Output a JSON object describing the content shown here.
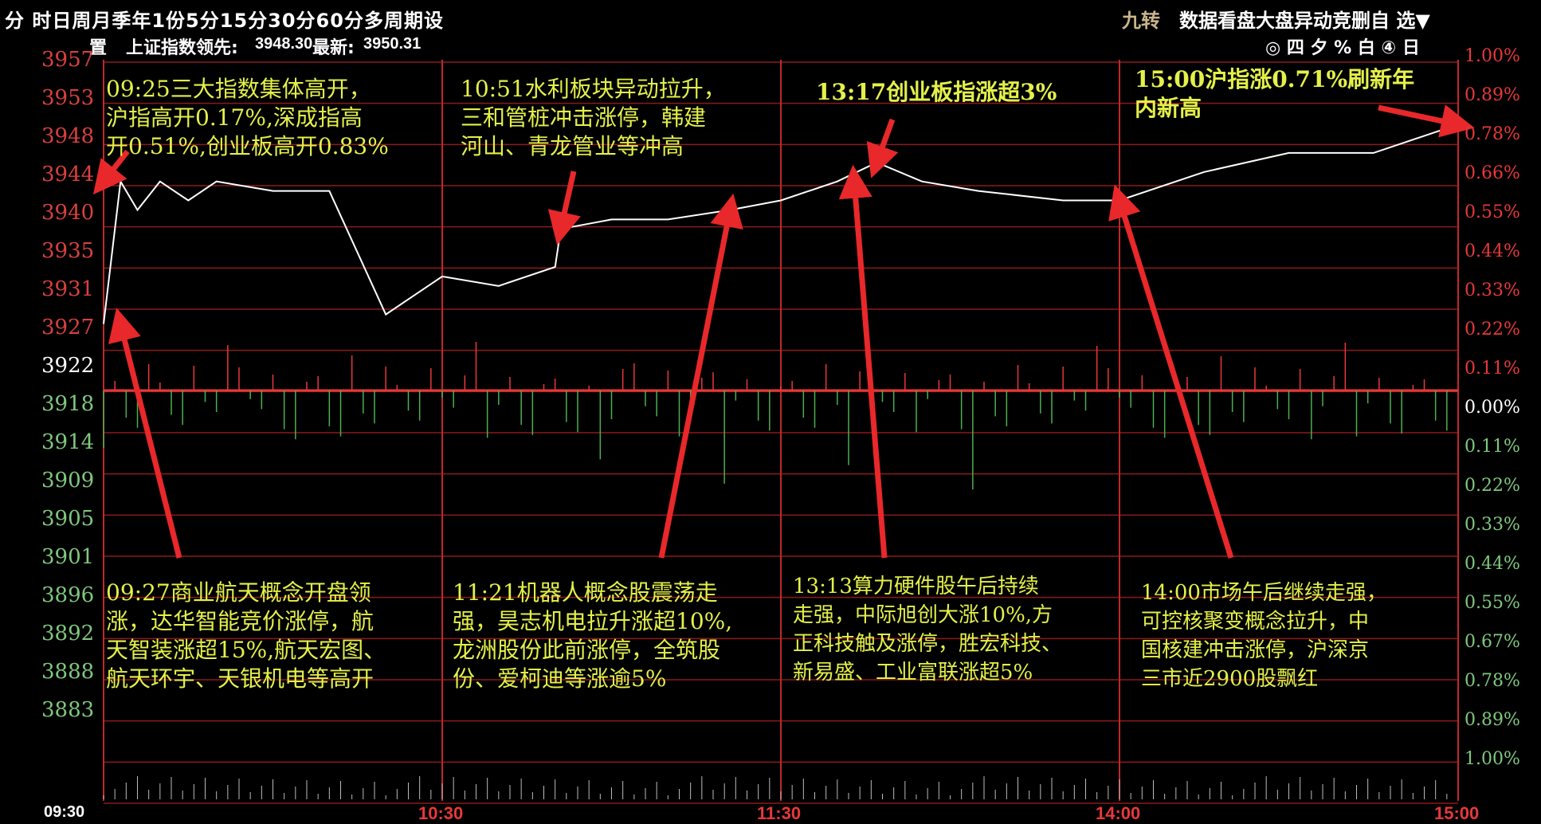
{
  "toolbar": {
    "period_menu": "分 时日周月季年1份5分15分30分60分多周期设",
    "period_menu_2": "置",
    "index_label": "上证指数领先:",
    "lead_value": "3948.30",
    "latest_label": "最新:",
    "latest_value": "3950.31",
    "right_menu_1": "九转",
    "right_menu_2": "数据看盘大盘异动竞删自 选▼",
    "right_icons": "◎ 四 夕 % 白 ④ 日"
  },
  "annotations": [
    {
      "id": "a1",
      "text": "09:25三大指数集体高开，\n沪指高开0.17%,深成指高\n开0.51%,创业板高开0.83%"
    },
    {
      "id": "a2",
      "text": "10:51水利板块异动拉升，\n三和管桩冲击涨停，韩建\n河山、青龙管业等冲高"
    },
    {
      "id": "a3",
      "text": "13:17创业板指涨超3%"
    },
    {
      "id": "a4",
      "text": "15:00沪指涨0.71%刷新年\n内新高"
    },
    {
      "id": "a5",
      "text": "09:27商业航天概念开盘领\n涨，达华智能竞价涨停，航\n天智装涨超15%,航天宏图、\n航天环宇、天银机电等高开"
    },
    {
      "id": "a6",
      "text": "11:21机器人概念股震荡走\n强，昊志机电拉升涨超10%,\n龙洲股份此前涨停，全筑股\n份、爱柯迪等涨逾5%"
    },
    {
      "id": "a7",
      "text": "13:13算力硬件股午后持续\n走强，中际旭创大涨10%,方\n正科技触及涨停，胜宏科技、\n新易盛、工业富联涨超5%"
    },
    {
      "id": "a8",
      "text": "14:00市场午后继续走强，\n可控核聚变概念拉升，中\n国核建冲击涨停，沪深京\n三市近2900股飘红"
    }
  ],
  "chart_data": {
    "type": "line",
    "title": "",
    "x_ticks": [
      "09:30",
      "10:30",
      "11:30",
      "14:00",
      "15:00"
    ],
    "y_left_ticks": [
      3957,
      3953,
      3948,
      3944,
      3940,
      3935,
      3931,
      3927,
      3922,
      3918,
      3914,
      3909,
      3905,
      3901,
      3896,
      3892,
      3888,
      3883
    ],
    "y_right_ticks": [
      "1.00%",
      "0.89%",
      "0.78%",
      "0.66%",
      "0.55%",
      "0.44%",
      "0.33%",
      "0.22%",
      "0.11%",
      "0.00%",
      "0.11%",
      "0.22%",
      "0.33%",
      "0.44%",
      "0.55%",
      "0.67%",
      "0.78%",
      "0.89%",
      "1.00%"
    ],
    "ylim": [
      3883,
      3961
    ],
    "prev_close": 3922,
    "series": [
      {
        "x": [
          "09:30",
          "09:33",
          "09:36",
          "09:40",
          "09:45",
          "09:50",
          "10:00",
          "10:10",
          "10:20",
          "10:30",
          "10:40",
          "10:50",
          "10:51",
          "11:00",
          "11:10",
          "11:21",
          "11:30",
          "13:05",
          "13:10",
          "13:17",
          "13:25",
          "13:35",
          "13:50",
          "14:00",
          "14:15",
          "14:30",
          "14:45",
          "15:00"
        ],
        "y": [
          3929,
          3944,
          3941,
          3944,
          3942,
          3944,
          3943,
          3943,
          3930,
          3934,
          3933,
          3935,
          3939,
          3940,
          3940,
          3941,
          3942,
          3943,
          3944,
          3946,
          3944,
          3943,
          3942,
          3942,
          3945,
          3947,
          3947,
          3950
        ]
      }
    ],
    "colors": {
      "up": "#e8383a",
      "down": "#4caf50",
      "price_line": "#ffffff",
      "grid": "#8b1a1a",
      "text": "#e4f04a"
    }
  }
}
